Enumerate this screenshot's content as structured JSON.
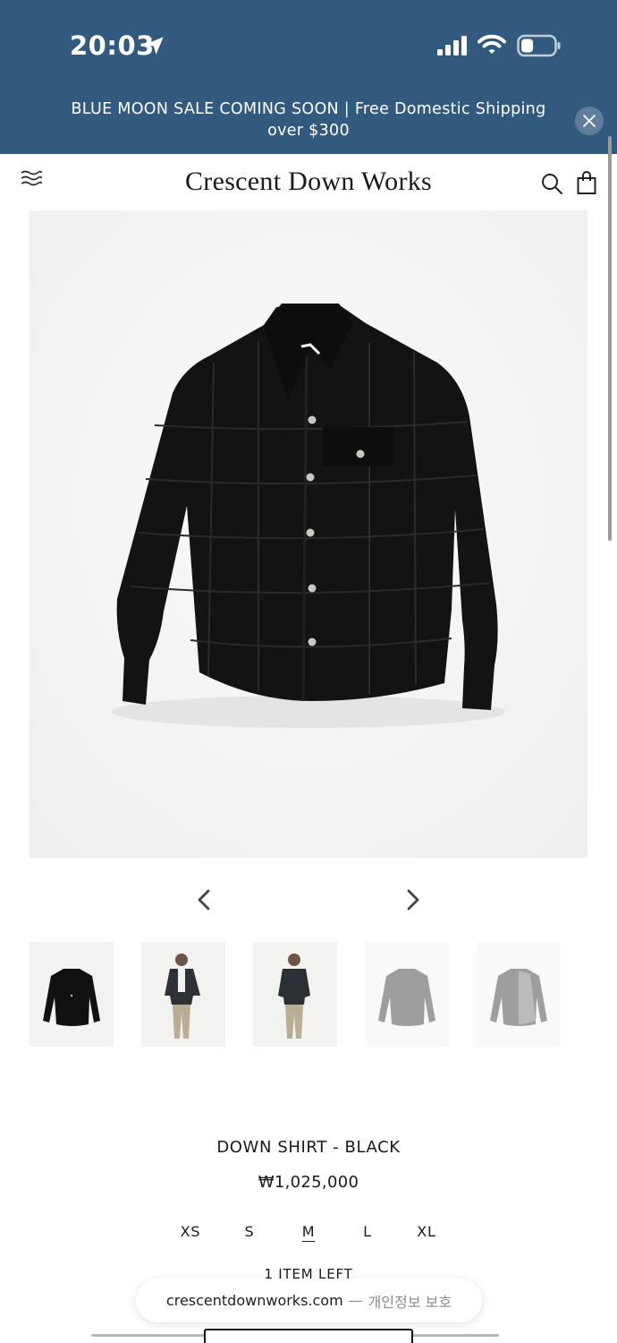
{
  "status_bar": {
    "time": "20:03",
    "icons": [
      "location-arrow-icon",
      "cellular-signal-icon",
      "wifi-icon",
      "battery-icon"
    ]
  },
  "announcement": {
    "text": "BLUE MOON SALE COMING SOON | Free Domestic Shipping over $300",
    "close_icon": "close-icon"
  },
  "header": {
    "logo": "Crescent Down Works",
    "icons": [
      "menu-icon",
      "search-icon",
      "bag-icon"
    ]
  },
  "gallery": {
    "main_image": "down-shirt-black-front",
    "prev_icon": "chevron-left-icon",
    "next_icon": "chevron-right-icon",
    "thumbnails": [
      {
        "name": "down-shirt-flat-front"
      },
      {
        "name": "model-front-open"
      },
      {
        "name": "model-front-closed"
      },
      {
        "name": "down-shirt-flat-back"
      },
      {
        "name": "down-shirt-flat-lining"
      }
    ]
  },
  "product": {
    "title": "DOWN SHIRT - BLACK",
    "price": "₩1,025,000",
    "sizes": [
      "XS",
      "S",
      "M",
      "L",
      "XL"
    ],
    "selected_size": "M",
    "stock": "1 ITEM LEFT"
  },
  "browser": {
    "domain": "crescentdownworks.com",
    "separator": "—",
    "note": "개인정보 보호"
  },
  "colors": {
    "top_band": "#325a7e",
    "text": "#1a1a1a",
    "jacket": "#121414"
  }
}
